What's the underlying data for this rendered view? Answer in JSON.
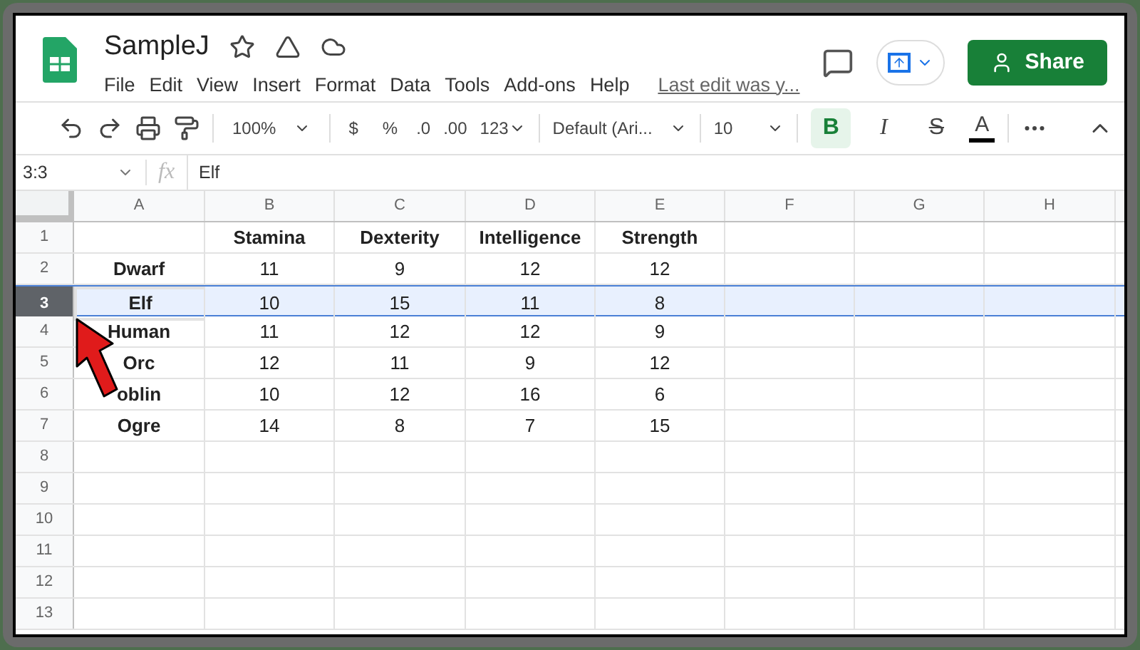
{
  "document": {
    "title": "SampleJ",
    "last_edit": "Last edit was y..."
  },
  "menu": [
    "File",
    "Edit",
    "View",
    "Insert",
    "Format",
    "Data",
    "Tools",
    "Add-ons",
    "Help"
  ],
  "share_button": "Share",
  "toolbar": {
    "zoom": "100%",
    "currency": "$",
    "percent": "%",
    "decimal_decrease": ".0",
    "decimal_increase": ".00",
    "number_format": "123",
    "font": "Default (Ari...",
    "font_size": "10",
    "format_buttons": [
      {
        "label": "B",
        "kind": "bold",
        "selected": true
      },
      {
        "label": "I",
        "kind": "italic",
        "selected": false
      },
      {
        "label": "S",
        "kind": "strike",
        "selected": false
      }
    ],
    "text_color": {
      "label": "A",
      "color": "#000000"
    }
  },
  "formula_bar": {
    "name_box": "3:3",
    "fx": "fx",
    "value": "Elf"
  },
  "columns": [
    "A",
    "B",
    "C",
    "D",
    "E",
    "F",
    "G",
    "H"
  ],
  "rows": [
    {
      "number": "1",
      "kind": "header",
      "selected": false,
      "values": [
        "Stamina",
        "Dexterity",
        "Intelligence",
        "Strength"
      ]
    },
    {
      "number": "2",
      "kind": "data",
      "selected": false,
      "label": "Dwarf",
      "values": [
        "11",
        "9",
        "12",
        "12"
      ]
    },
    {
      "number": "3",
      "kind": "data",
      "selected": true,
      "label": "Elf",
      "values": [
        "10",
        "15",
        "11",
        "8"
      ]
    },
    {
      "number": "4",
      "kind": "data",
      "selected": false,
      "label": "Human",
      "values": [
        "11",
        "12",
        "12",
        "9"
      ]
    },
    {
      "number": "5",
      "kind": "data",
      "selected": false,
      "label": "Orc",
      "values": [
        "12",
        "11",
        "9",
        "12"
      ]
    },
    {
      "number": "6",
      "kind": "data",
      "selected": false,
      "label": "oblin",
      "values": [
        "10",
        "12",
        "16",
        "6"
      ]
    },
    {
      "number": "7",
      "kind": "data",
      "selected": false,
      "label": "Ogre",
      "values": [
        "14",
        "8",
        "7",
        "15"
      ]
    },
    {
      "number": "8",
      "kind": "empty",
      "selected": false
    },
    {
      "number": "9",
      "kind": "empty",
      "selected": false
    },
    {
      "number": "10",
      "kind": "empty",
      "selected": false
    },
    {
      "number": "11",
      "kind": "empty",
      "selected": false
    },
    {
      "number": "12",
      "kind": "empty",
      "selected": false
    },
    {
      "number": "13",
      "kind": "empty",
      "selected": false
    }
  ]
}
